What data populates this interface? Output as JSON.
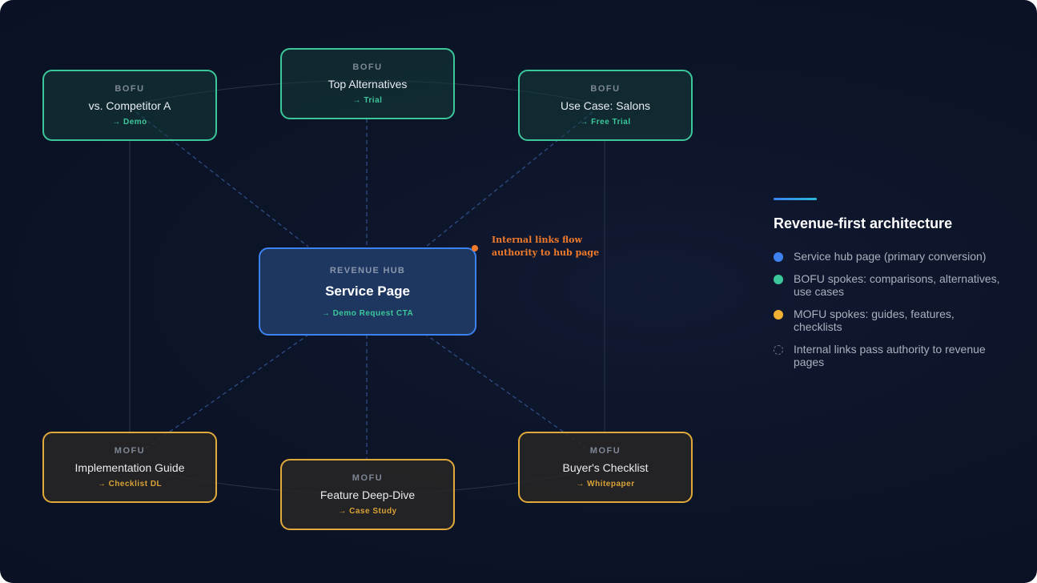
{
  "diagram": {
    "hub": {
      "tag": "REVENUE HUB",
      "title": "Service Page",
      "cta": "→ Demo Request CTA"
    },
    "bofu_nodes": [
      {
        "tag": "BOFU",
        "title": "vs. Competitor A",
        "cta": "→ Demo"
      },
      {
        "tag": "BOFU",
        "title": "Top Alternatives",
        "cta": "→ Trial"
      },
      {
        "tag": "BOFU",
        "title": "Use Case: Salons",
        "cta": "→ Free Trial"
      }
    ],
    "mofu_nodes": [
      {
        "tag": "MOFU",
        "title": "Implementation Guide",
        "cta": "→ Checklist DL"
      },
      {
        "tag": "MOFU",
        "title": "Feature Deep-Dive",
        "cta": "→ Case Study"
      },
      {
        "tag": "MOFU",
        "title": "Buyer's Checklist",
        "cta": "→ Whitepaper"
      }
    ],
    "annotation": "Internal links flow authority to hub page"
  },
  "legend": {
    "heading": "Revenue-first architecture",
    "items": [
      {
        "label": "Service hub page (primary conversion)",
        "icon": "blue-dot"
      },
      {
        "label": "BOFU spokes: comparisons, alternatives, use cases",
        "icon": "green-dot"
      },
      {
        "label": "MOFU spokes: guides, features, checklists",
        "icon": "amber-dot"
      },
      {
        "label": "Internal links pass authority to revenue pages",
        "icon": "dashed-circle"
      }
    ]
  },
  "colors": {
    "hub": "#3d82f0",
    "bofu": "#3cc79a",
    "mofu": "#e0a93a",
    "annotation": "#f07a2a",
    "background": "#0c1428"
  }
}
